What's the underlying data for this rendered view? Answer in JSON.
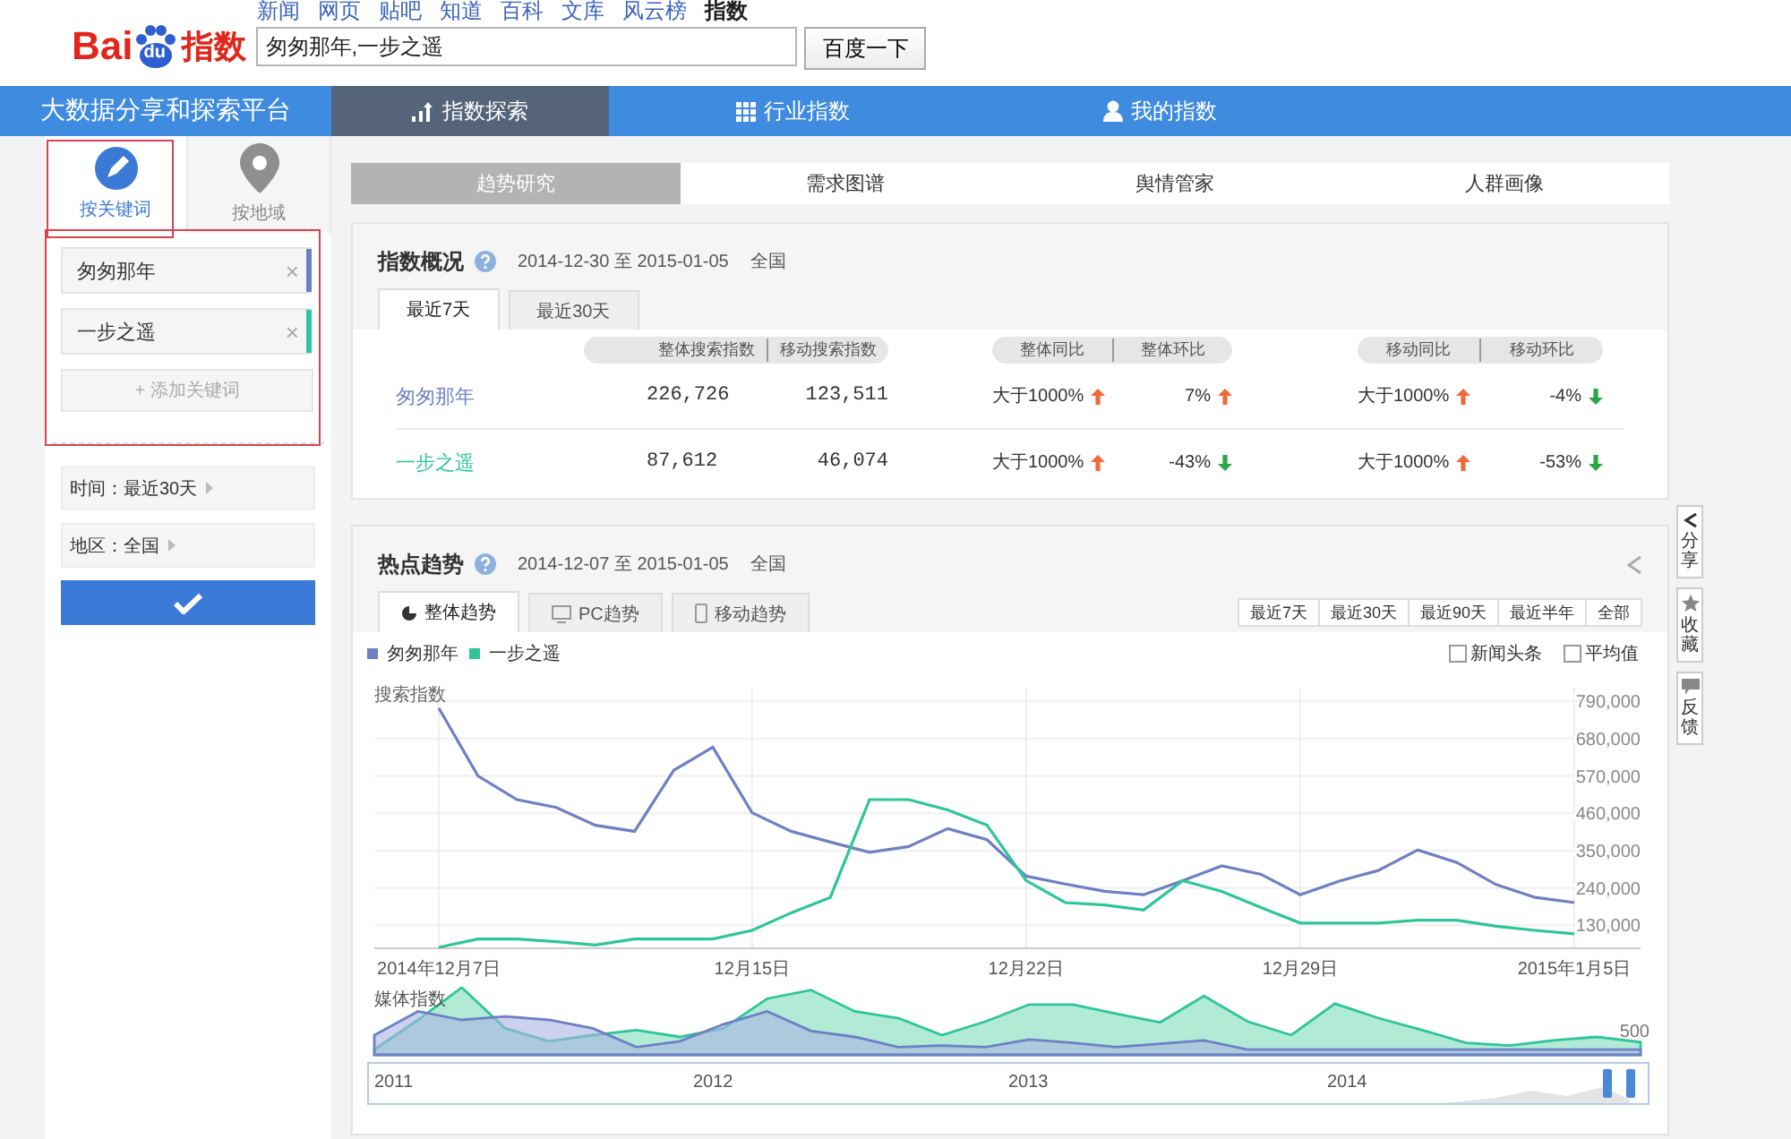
{
  "header": {
    "logo": {
      "left": "Bai",
      "paw": "du",
      "right": "指数"
    },
    "links": [
      {
        "label": "新闻",
        "selected": false
      },
      {
        "label": "网页",
        "selected": false
      },
      {
        "label": "贴吧",
        "selected": false
      },
      {
        "label": "知道",
        "selected": false
      },
      {
        "label": "百科",
        "selected": false
      },
      {
        "label": "文库",
        "selected": false
      },
      {
        "label": "风云榜",
        "selected": false
      },
      {
        "label": "指数",
        "selected": true
      }
    ],
    "search": {
      "value": "匆匆那年,一步之遥"
    },
    "search_button": "百度一下"
  },
  "nav": {
    "title": "大数据分享和探索平台",
    "tabs": [
      {
        "label": "指数探索",
        "selected": true
      },
      {
        "label": "行业指数",
        "selected": false
      },
      {
        "label": "我的指数",
        "selected": false
      }
    ]
  },
  "sidebar": {
    "modes": [
      {
        "label": "按关键词",
        "selected": true
      },
      {
        "label": "按地域",
        "selected": false
      }
    ],
    "keywords": [
      {
        "name": "匆匆那年",
        "color": "#6f7fc6",
        "remove": "×"
      },
      {
        "name": "一步之遥",
        "color": "#2ec59a",
        "remove": "×"
      }
    ],
    "add_keyword": "+ 添加关键词",
    "filters": [
      "时间：最近30天",
      "地区：全国"
    ]
  },
  "main_tabs": [
    {
      "label": "趋势研究",
      "selected": true
    },
    {
      "label": "需求图谱",
      "selected": false
    },
    {
      "label": "舆情管家",
      "selected": false
    },
    {
      "label": "人群画像",
      "selected": false
    }
  ],
  "overview": {
    "title": "指数概况",
    "date_range": "2014-12-30 至 2015-01-05",
    "region": "全国",
    "tabs": [
      {
        "label": "最近7天",
        "selected": true
      },
      {
        "label": "最近30天",
        "selected": false
      }
    ],
    "header_groups": [
      [
        "整体搜索指数",
        "移动搜索指数"
      ],
      [
        "整体同比",
        "整体环比"
      ],
      [
        "移动同比",
        "移动环比"
      ]
    ],
    "rows": [
      {
        "name": "匆匆那年",
        "color": "#6f7fc6",
        "search": "226,726",
        "mobile": "123,511",
        "changes": [
          {
            "value": "大于1000%",
            "rising": true
          },
          {
            "value": "7%",
            "rising": true
          },
          {
            "value": "大于1000%",
            "rising": true
          },
          {
            "value": "-4%",
            "rising": false
          }
        ]
      },
      {
        "name": "一步之遥",
        "color": "#2ec59a",
        "search": "87,612",
        "mobile": "46,074",
        "changes": [
          {
            "value": "大于1000%",
            "rising": true
          },
          {
            "value": "-43%",
            "rising": false
          },
          {
            "value": "大于1000%",
            "rising": true
          },
          {
            "value": "-53%",
            "rising": false
          }
        ]
      }
    ]
  },
  "trend": {
    "title": "热点趋势",
    "date_range": "2014-12-07 至 2015-01-05",
    "region": "全国",
    "tabs": [
      {
        "label": "整体趋势",
        "selected": true
      },
      {
        "label": "PC趋势",
        "selected": false
      },
      {
        "label": "移动趋势",
        "selected": false
      }
    ],
    "ranges": [
      "最近7天",
      "最近30天",
      "最近90天",
      "最近半年",
      "全部"
    ],
    "options": [
      {
        "label": "新闻头条",
        "checked": false
      },
      {
        "label": "平均值",
        "checked": false
      }
    ],
    "chart_data": {
      "type": "line",
      "ylabel": "搜索指数",
      "categories": [
        "2014年12月7日",
        null,
        null,
        null,
        null,
        null,
        null,
        null,
        "12月15日",
        null,
        null,
        null,
        null,
        null,
        null,
        "12月22日",
        null,
        null,
        null,
        null,
        null,
        null,
        "12月29日",
        null,
        null,
        null,
        null,
        null,
        null,
        "2015年1月5日"
      ],
      "ylim": [
        65000,
        830000
      ],
      "grid": true,
      "yticks": [
        {
          "value": 130000,
          "label": "130,000"
        },
        {
          "value": 240000,
          "label": "240,000"
        },
        {
          "value": 350000,
          "label": "350,000"
        },
        {
          "value": 460000,
          "label": "460,000"
        },
        {
          "value": 570000,
          "label": "570,000"
        },
        {
          "value": 680000,
          "label": "680,000"
        },
        {
          "value": 790000,
          "label": "790,000"
        }
      ],
      "series": [
        {
          "name": "匆匆那年",
          "color": "#6f7fc6",
          "values": [
            770000,
            570000,
            500000,
            477000,
            425000,
            407000,
            587000,
            655000,
            462000,
            407000,
            375000,
            345000,
            362000,
            415000,
            382000,
            275000,
            252000,
            230000,
            220000,
            262000,
            305000,
            280000,
            220000,
            260000,
            292000,
            352000,
            315000,
            250000,
            212000,
            197000
          ]
        },
        {
          "name": "一步之遥",
          "color": "#2ec59a",
          "values": [
            65000,
            90000,
            90000,
            82000,
            72000,
            90000,
            90000,
            90000,
            115000,
            167000,
            212000,
            500000,
            500000,
            470000,
            425000,
            262000,
            197000,
            190000,
            175000,
            262000,
            230000,
            182000,
            137000,
            137000,
            137000,
            145000,
            145000,
            127000,
            115000,
            105000
          ]
        }
      ]
    },
    "media": {
      "label": "媒体指数",
      "tick": "500"
    },
    "navigator": {
      "years": [
        "2011",
        "2012",
        "2013",
        "2014"
      ]
    }
  },
  "side_tools": [
    "分享",
    "收藏",
    "反馈"
  ]
}
